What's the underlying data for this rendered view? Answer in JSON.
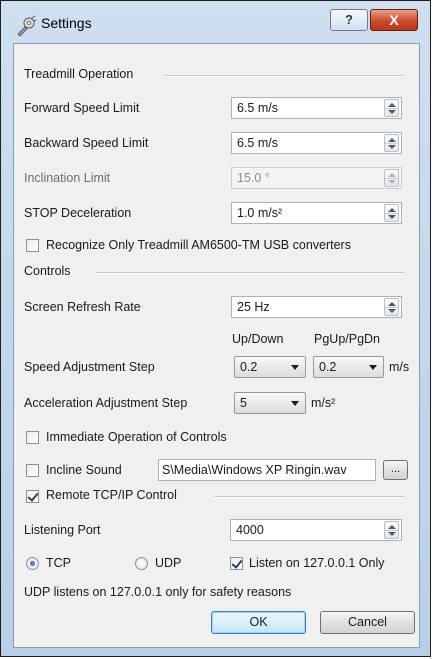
{
  "window": {
    "title": "Settings",
    "help_label": "?",
    "close_label": "X"
  },
  "treadmill": {
    "group_label": "Treadmill Operation",
    "forward_label": "Forward Speed Limit",
    "forward_value": "6.5 m/s",
    "backward_label": "Backward Speed Limit",
    "backward_value": "6.5 m/s",
    "incline_label": "Inclination Limit",
    "incline_value": "15.0 °",
    "stop_label": "STOP Deceleration",
    "stop_value": "1.0 m/s²",
    "recognize_label": "Recognize Only Treadmill AM6500-TM USB converters",
    "recognize_checked": false
  },
  "controls": {
    "group_label": "Controls",
    "refresh_label": "Screen Refresh Rate",
    "refresh_value": "25 Hz",
    "col_updown": "Up/Down",
    "col_pgupdn": "PgUp/PgDn",
    "speed_step_label": "Speed Adjustment Step",
    "speed_step_updown": "0.2",
    "speed_step_pg": "0.2",
    "speed_unit": "m/s",
    "accel_step_label": "Acceleration Adjustment Step",
    "accel_step_value": "5",
    "accel_unit": "m/s²",
    "immediate_label": "Immediate Operation of Controls",
    "immediate_checked": false,
    "incline_sound_label": "Incline Sound",
    "incline_sound_checked": false,
    "incline_sound_path": "S\\Media\\Windows XP Ringin.wav",
    "browse_label": "..."
  },
  "remote": {
    "group_label": "Remote TCP/IP Control",
    "checked": true,
    "port_label": "Listening Port",
    "port_value": "4000",
    "tcp_label": "TCP",
    "udp_label": "UDP",
    "protocol": "TCP",
    "localonly_label": "Listen on 127.0.0.1 Only",
    "localonly_checked": true,
    "note": "UDP listens on 127.0.0.1 only for safety reasons"
  },
  "buttons": {
    "ok_label": "OK",
    "cancel_label": "Cancel"
  }
}
